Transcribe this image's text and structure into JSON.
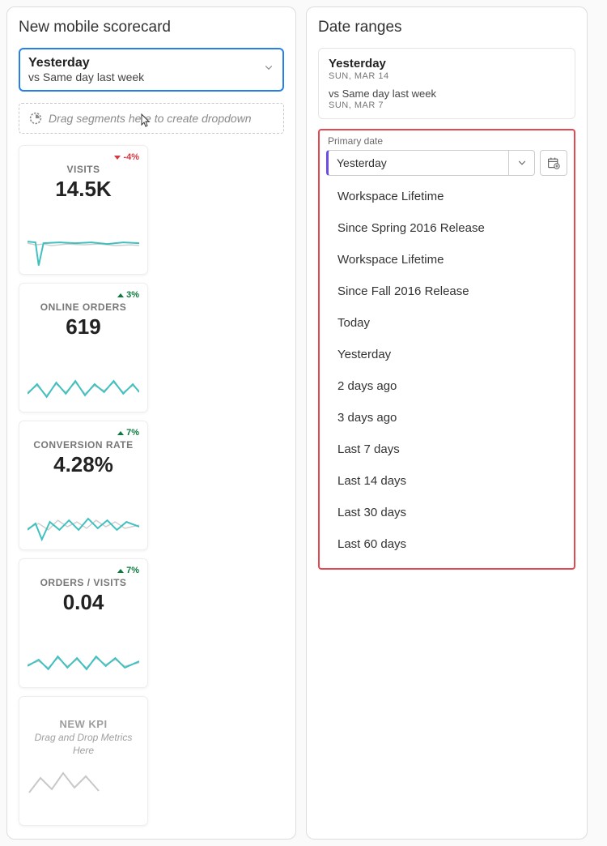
{
  "left": {
    "title": "New mobile scorecard",
    "range": {
      "primary": "Yesterday",
      "secondary": "vs Same day last week"
    },
    "dropzone": "Drag segments here to create dropdown",
    "cards": [
      {
        "label": "VISITS",
        "value": "14.5K",
        "trend": "-4%",
        "dir": "down"
      },
      {
        "label": "ONLINE ORDERS",
        "value": "619",
        "trend": "3%",
        "dir": "up"
      },
      {
        "label": "CONVERSION RATE",
        "value": "4.28%",
        "trend": "7%",
        "dir": "up"
      },
      {
        "label": "ORDERS / VISITS",
        "value": "0.04",
        "trend": "7%",
        "dir": "up"
      }
    ],
    "newkpi": {
      "title": "NEW KPI",
      "sub": "Drag and Drop Metrics Here"
    }
  },
  "right": {
    "title": "Date ranges",
    "summary": {
      "primary": "Yesterday",
      "primary_sub": "SUN, MAR 14",
      "vs": "vs Same day last week",
      "vs_sub": "SUN, MAR 7"
    },
    "field_label": "Primary date",
    "selected": "Yesterday",
    "options": [
      "Workspace Lifetime",
      "Since Spring 2016 Release",
      "Workspace Lifetime",
      "Since Fall 2016 Release",
      "Today",
      "Yesterday",
      "2 days ago",
      "3 days ago",
      "Last 7 days",
      "Last 14 days",
      "Last 30 days",
      "Last 60 days"
    ]
  }
}
